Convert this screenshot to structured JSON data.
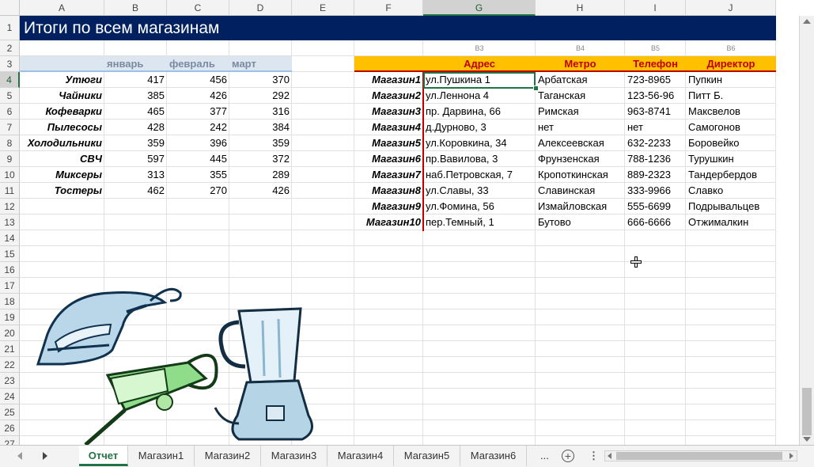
{
  "columns": [
    "A",
    "B",
    "C",
    "D",
    "E",
    "F",
    "G",
    "H",
    "I",
    "J"
  ],
  "rows": [
    "1",
    "2",
    "3",
    "4",
    "5",
    "6",
    "7",
    "8",
    "9",
    "10",
    "11",
    "12",
    "13",
    "14",
    "15",
    "16",
    "17",
    "18",
    "19",
    "20",
    "21",
    "22",
    "23",
    "24",
    "25",
    "26",
    "27"
  ],
  "title": "Итоги по всем магазинам",
  "summary": {
    "months": [
      "январь",
      "февраль",
      "март"
    ],
    "items": [
      {
        "name": "Утюги",
        "jan": "417",
        "feb": "456",
        "mar": "370"
      },
      {
        "name": "Чайники",
        "jan": "385",
        "feb": "426",
        "mar": "292"
      },
      {
        "name": "Кофеварки",
        "jan": "465",
        "feb": "377",
        "mar": "316"
      },
      {
        "name": "Пылесосы",
        "jan": "428",
        "feb": "242",
        "mar": "384"
      },
      {
        "name": "Холодильники",
        "jan": "359",
        "feb": "396",
        "mar": "359"
      },
      {
        "name": "СВЧ",
        "jan": "597",
        "feb": "445",
        "mar": "372"
      },
      {
        "name": "Миксеры",
        "jan": "313",
        "feb": "355",
        "mar": "289"
      },
      {
        "name": "Тостеры",
        "jan": "462",
        "feb": "270",
        "mar": "426"
      }
    ]
  },
  "stores": {
    "refs": [
      "B3",
      "B4",
      "B5",
      "B6"
    ],
    "headers": [
      "Адрес",
      "Метро",
      "Телефон",
      "Директор"
    ],
    "rows": [
      {
        "store": "Магазин1",
        "addr": "ул.Пушкина 1",
        "metro": "Арбатская",
        "phone": "723-8965",
        "dir": "Пупкин"
      },
      {
        "store": "Магазин2",
        "addr": "ул.Леннона 4",
        "metro": "Таганская",
        "phone": "123-56-96",
        "dir": "Питт Б."
      },
      {
        "store": "Магазин3",
        "addr": "пр. Дарвина, 66",
        "metro": "Римская",
        "phone": "963-8741",
        "dir": "Максвелов"
      },
      {
        "store": "Магазин4",
        "addr": "д.Дурново, 3",
        "metro": "нет",
        "phone": "нет",
        "dir": "Самогонов"
      },
      {
        "store": "Магазин5",
        "addr": "ул.Коровкина, 34",
        "metro": "Алексеевская",
        "phone": "632-2233",
        "dir": "Боровейко"
      },
      {
        "store": "Магазин6",
        "addr": "пр.Вавилова, 3",
        "metro": "Фрунзенская",
        "phone": "788-1236",
        "dir": "Турушкин"
      },
      {
        "store": "Магазин7",
        "addr": "наб.Петровская, 7",
        "metro": "Кропоткинская",
        "phone": "889-2323",
        "dir": "Тандербердов"
      },
      {
        "store": "Магазин8",
        "addr": "ул.Славы, 33",
        "metro": "Славинская",
        "phone": "333-9966",
        "dir": "Славко"
      },
      {
        "store": "Магазин9",
        "addr": "ул.Фомина, 56",
        "metro": "Измайловская",
        "phone": "555-6699",
        "dir": "Подрывальцев"
      },
      {
        "store": "Магазин10",
        "addr": "пер.Темный, 1",
        "metro": "Бутово",
        "phone": "666-6666",
        "dir": "Отжималкин"
      }
    ]
  },
  "tabs": [
    "Отчет",
    "Магазин1",
    "Магазин2",
    "Магазин3",
    "Магазин4",
    "Магазин5",
    "Магазин6"
  ],
  "tabs_more": "...",
  "colors": {
    "title_bg": "#002060",
    "header_bg": "#ffc000",
    "header_text": "#c00000",
    "accent": "#217346",
    "month_bg": "#dce6f1"
  },
  "icons": [
    "iron-clipart",
    "blender-clipart",
    "vacuum-clipart",
    "add-sheet-icon",
    "options-icon",
    "scroll-left-icon",
    "scroll-right-icon",
    "cursor-cross-icon"
  ]
}
